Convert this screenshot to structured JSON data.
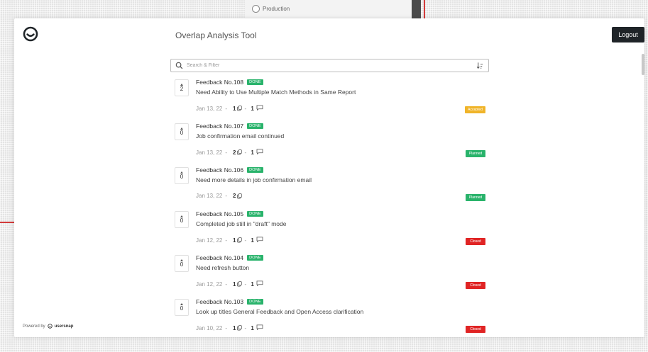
{
  "background": {
    "environment_label": "Production"
  },
  "header": {
    "title": "Overlap Analysis Tool",
    "logout_label": "Logout"
  },
  "search": {
    "placeholder": "Search & Filter"
  },
  "feedback": [
    {
      "number": "Feedback No.108",
      "badge": "DONE",
      "title": "Need Ability to Use Multiple Match Methods in Same Report",
      "votes": "2",
      "date": "Jan 13, 22",
      "attachments": "1",
      "comments": "1",
      "status": "Accepted",
      "status_color": "#f0b429"
    },
    {
      "number": "Feedback No.107",
      "badge": "DONE",
      "title": "Job confirmation email continued",
      "votes": "0",
      "date": "Jan 13, 22",
      "attachments": "2",
      "comments": "1",
      "status": "Planned",
      "status_color": "#29b36b"
    },
    {
      "number": "Feedback No.106",
      "badge": "DONE",
      "title": "Need more details in job confirmation email",
      "votes": "0",
      "date": "Jan 13, 22",
      "attachments": "2",
      "comments": "",
      "status": "Planned",
      "status_color": "#29b36b"
    },
    {
      "number": "Feedback No.105",
      "badge": "DONE",
      "title": "Completed job still in \"draft\" mode",
      "votes": "0",
      "date": "Jan 12, 22",
      "attachments": "1",
      "comments": "1",
      "status": "Closed",
      "status_color": "#e02424"
    },
    {
      "number": "Feedback No.104",
      "badge": "DONE",
      "title": "Need refresh button",
      "votes": "0",
      "date": "Jan 12, 22",
      "attachments": "1",
      "comments": "1",
      "status": "Closed",
      "status_color": "#e02424"
    },
    {
      "number": "Feedback No.103",
      "badge": "DONE",
      "title": "Look up titles General Feedback and Open Access clarification",
      "votes": "0",
      "date": "Jan 10, 22",
      "attachments": "1",
      "comments": "1",
      "status": "Closed",
      "status_color": "#e02424"
    }
  ],
  "footer": {
    "powered_by": "Powered by",
    "brand": "usersnap"
  },
  "icons": {
    "logo": "circle-check-logo-icon",
    "search": "search-icon",
    "sort": "sort-icon",
    "attachment": "attachment-icon",
    "comment": "comment-icon"
  }
}
